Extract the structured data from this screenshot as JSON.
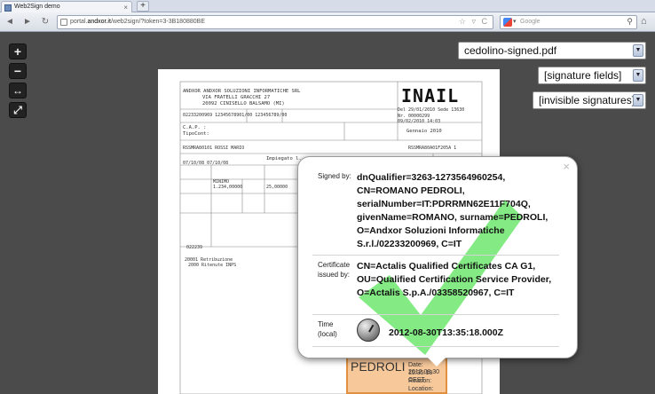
{
  "browser": {
    "tab_title": "Web2Sign demo",
    "tab_close": "×",
    "new_tab": "+",
    "url_prefix": "portal.",
    "url_host": "andxor.it",
    "url_path": "/web2sign/?token=3-3B180880BE",
    "search_placeholder": "Google",
    "url_icons": "☆ ▿ C",
    "back": "◄",
    "forward": "►",
    "reload": "↻",
    "home": "⌂",
    "search_mag": "⚲"
  },
  "viewer": {
    "zoom_in": "+",
    "zoom_out": "−",
    "fit_width": "↔",
    "fit_page": "⤢",
    "file_select": "cedolino-signed.pdf",
    "fields_select": "[signature fields]",
    "invisible_select": "[invisible signatures]",
    "select_arrow": "▼"
  },
  "document": {
    "company": "ANDXOR ANDXOR SOLUZIONI INFORMATICHE SRL",
    "street": "VIA FRATELLI GRACCHI          27",
    "city": "20092  CINISELLO BALSAMO            (MI)",
    "codes": "02233200969     12345678901/00  123456789/00",
    "cap": "C.A.P. :",
    "tipocont": "TipoCont:",
    "inail": "INAIL",
    "period": "Del 29/01/2010  Sede 13630",
    "num": "Nr. 00000299",
    "date": "09/02/2010     14:03",
    "month": "Gennaio  2010",
    "fiscal": "RSSMRA80A01F205A    1",
    "employee": "RSSMRA80101 ROSSI MARIO",
    "role": "Impiegato l.",
    "dates": "07/10/08  07/10/08",
    "minimo": "MINIMO",
    "amount1": "1.234,00000",
    "amount2": "25,00000",
    "line1": "20001 Retribuzione",
    "line2": "2000 Ritenute INPS",
    "code": "022239",
    "stamp_name": "PEDROLI",
    "stamp_date": "Date: 2012.08.30",
    "stamp_time": "15:35:18 CEST",
    "stamp_reason": "Reason:",
    "stamp_location": "Location:"
  },
  "signature_popup": {
    "close": "×",
    "signed_by_label": "Signed by:",
    "signed_by_value": "dnQualifier=3263-1273564960254, CN=ROMANO PEDROLI, serialNumber=IT:PDRRMN62E11F704Q, givenName=ROMANO, surname=PEDROLI, O=Andxor Soluzioni Informatiche S.r.l./02233200969, C=IT",
    "issuer_label": "Certificate issued by:",
    "issuer_value": "CN=Actalis Qualified Certificates CA G1, OU=Qualified Certification Service Provider, O=Actalis S.p.A./03358520967, C=IT",
    "time_label": "Time (local)",
    "time_value": "2012-08-30T13:35:18.000Z",
    "check_color": "#6ee86e"
  }
}
